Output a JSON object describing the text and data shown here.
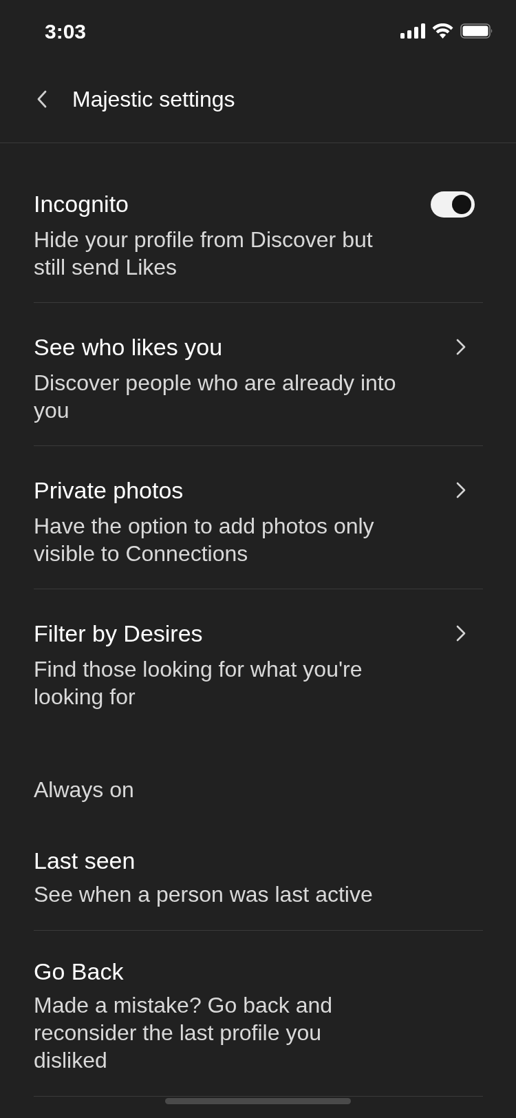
{
  "status_bar": {
    "time": "3:03"
  },
  "header": {
    "title": "Majestic settings"
  },
  "settings": [
    {
      "kind": "toggle",
      "title": "Incognito",
      "description": "Hide your profile from Discover but still send Likes",
      "on": true
    },
    {
      "kind": "link",
      "title": "See who likes you",
      "description": "Discover people who are already into you"
    },
    {
      "kind": "link",
      "title": "Private photos",
      "description": "Have the option to add photos only visible to Connections"
    },
    {
      "kind": "link",
      "title": "Filter by Desires",
      "description": "Find those looking for what you're looking for"
    }
  ],
  "always_on": {
    "heading": "Always on",
    "items": [
      {
        "title": "Last seen",
        "description": "See when a person was last active"
      },
      {
        "title": "Go Back",
        "description": "Made a mistake? Go back and reconsider the last profile you disliked"
      }
    ]
  }
}
